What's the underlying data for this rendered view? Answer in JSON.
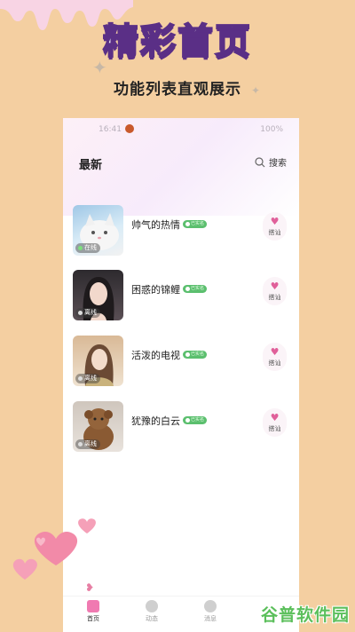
{
  "promo": {
    "headline": "精彩首页",
    "subline": "功能列表直观展示"
  },
  "status_bar": {
    "time": "16:41",
    "battery": "100%"
  },
  "page": {
    "title": "最新",
    "search_label": "搜索"
  },
  "users": [
    {
      "name": "帅气的热情",
      "status": "在线",
      "badge": "已实名",
      "greet": "搭讪",
      "avatar_icon": "cat-photo"
    },
    {
      "name": "困惑的锦鲤",
      "status": "离线",
      "badge": "已实名",
      "greet": "搭讪",
      "avatar_icon": "woman-photo"
    },
    {
      "name": "活泼的电视",
      "status": "离线",
      "badge": "已实名",
      "greet": "搭讪",
      "avatar_icon": "woman-photo"
    },
    {
      "name": "犹豫的白云",
      "status": "离线",
      "badge": "已实名",
      "greet": "搭讪",
      "avatar_icon": "dog-photo"
    }
  ],
  "tabs": [
    {
      "label": "首页",
      "icon": "home-icon",
      "active": true
    },
    {
      "label": "动态",
      "icon": "compass-icon",
      "active": false
    },
    {
      "label": "消息",
      "icon": "chat-icon",
      "active": false
    }
  ],
  "watermark": "谷普软件园",
  "colors": {
    "background": "#f4cfa1",
    "accent_pink": "#e0609a",
    "verified_green": "#5bbf6e",
    "headline_stroke": "#5a2f86"
  }
}
